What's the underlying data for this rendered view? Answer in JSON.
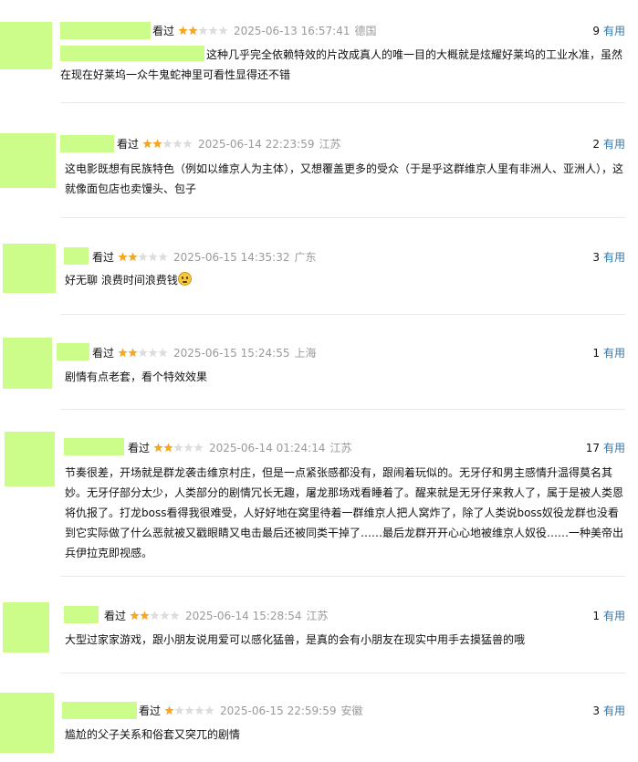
{
  "reviews": [
    {
      "watched_label": "看过",
      "rating": 2,
      "time": "2025-06-13 16:57:41",
      "location": "德国",
      "useful_count": "9",
      "useful_label": "有用",
      "content": "这种几乎完全依赖特效的片改成真人的唯一目的大概就是炫耀好莱坞的工业水准，虽然在现在好莱坞一众牛鬼蛇神里可看性显得还不错"
    },
    {
      "watched_label": "看过",
      "rating": 2,
      "time": "2025-06-14 22:23:59",
      "location": "江苏",
      "useful_count": "2",
      "useful_label": "有用",
      "content": "这电影既想有民族特色（例如以维京人为主体），又想覆盖更多的受众（于是乎这群维京人里有非洲人、亚洲人），这就像面包店也卖馒头、包子"
    },
    {
      "watched_label": "看过",
      "rating": 2,
      "time": "2025-06-15 14:35:32",
      "location": "广东",
      "useful_count": "3",
      "useful_label": "有用",
      "content": "好无聊 浪费时间浪费钱"
    },
    {
      "watched_label": "看过",
      "rating": 2,
      "time": "2025-06-15 15:24:55",
      "location": "上海",
      "useful_count": "1",
      "useful_label": "有用",
      "content": "剧情有点老套，看个特效效果"
    },
    {
      "watched_label": "看过",
      "rating": 2,
      "time": "2025-06-14 01:24:14",
      "location": "江苏",
      "useful_count": "17",
      "useful_label": "有用",
      "content": "节奏很差，开场就是群龙袭击维京村庄，但是一点紧张感都没有，跟闹着玩似的。无牙仔和男主感情升温得莫名其妙。无牙仔部分太少，人类部分的剧情冗长无趣，屠龙那场戏看睡着了。醒来就是无牙仔来救人了，属于是被人类恩将仇报了。打龙boss看得我很难受，人好好地在窝里待着一群维京人把人窝炸了，除了人类说boss奴役龙群也没看到它实际做了什么恶就被又戳眼睛又电击最后还被同类干掉了……最后龙群开开心心地被维京人奴役……一种美帝出兵伊拉克即视感。"
    },
    {
      "watched_label": "看过",
      "rating": 2,
      "time": "2025-06-14 15:28:54",
      "location": "江苏",
      "useful_count": "1",
      "useful_label": "有用",
      "content": "大型过家家游戏，跟小朋友说用爱可以感化猛兽，是真的会有小朋友在现实中用手去摸猛兽的哦"
    },
    {
      "watched_label": "看过",
      "rating": 1,
      "time": "2025-06-15 22:59:59",
      "location": "安徽",
      "useful_count": "3",
      "useful_label": "有用",
      "content": "尴尬的父子关系和俗套又突兀的剧情"
    }
  ],
  "colors": {
    "highlight": "#ccfc89",
    "link": "#3377aa",
    "star_on": "#f5a623",
    "star_off": "#dddddd",
    "meta_gray": "#9a9a9a"
  },
  "icons": {
    "star": "star-icon",
    "emoji": "embarrassed-face-emoji-icon"
  }
}
